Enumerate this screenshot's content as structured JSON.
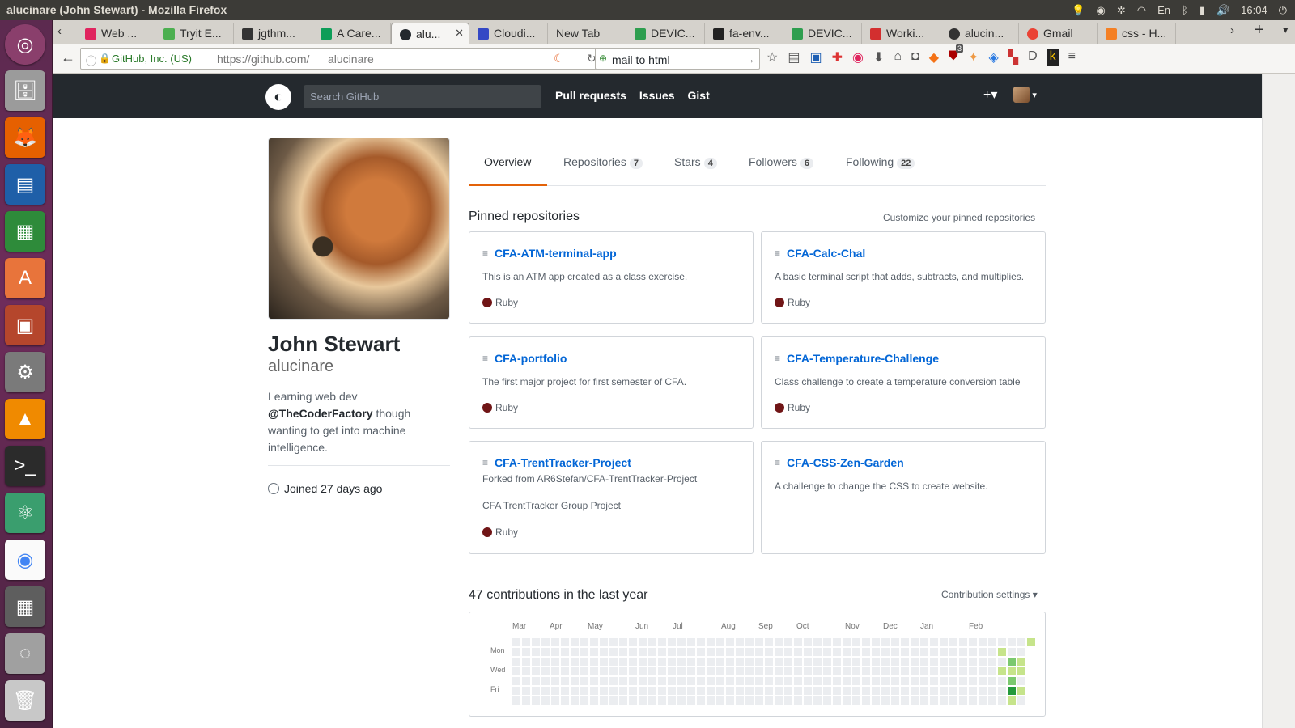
{
  "os": {
    "window_title": "alucinare (John Stewart) - Mozilla Firefox",
    "tray": {
      "lang": "En",
      "time": "16:04"
    }
  },
  "browser": {
    "tabs": [
      {
        "label": "Web ...",
        "color": "#e0245e"
      },
      {
        "label": "Tryit E...",
        "color": "#4caf50"
      },
      {
        "label": "jgthm...",
        "color": "#333333"
      },
      {
        "label": "A Care...",
        "color": "#0d9d58"
      },
      {
        "label": "alu...",
        "color": "#24292e",
        "active": true
      },
      {
        "label": "Cloudi...",
        "color": "#3448c5"
      },
      {
        "label": "New Tab",
        "color": ""
      },
      {
        "label": "DEVIC...",
        "color": "#2e9e4f"
      },
      {
        "label": "fa-env...",
        "color": "#222222"
      },
      {
        "label": "DEVIC...",
        "color": "#2e9e4f"
      },
      {
        "label": "Worki...",
        "color": "#d32f2f"
      },
      {
        "label": "alucin...",
        "color": "#333333"
      },
      {
        "label": "Gmail",
        "color": "#ea4335"
      },
      {
        "label": "css - H...",
        "color": "#f48024"
      }
    ],
    "url": {
      "identity": "GitHub, Inc. (US)",
      "prefix": "https://github.com/",
      "path": "alucinare"
    },
    "search_value": "mail to html",
    "notification_badge": "3"
  },
  "github": {
    "search_placeholder": "Search GitHub",
    "nav": [
      "Pull requests",
      "Issues",
      "Gist"
    ],
    "plus": "+▾"
  },
  "profile": {
    "name": "John Stewart",
    "login": "alucinare",
    "bio_pre": "Learning web dev",
    "bio_mention": "@TheCoderFactory",
    "bio_post": " though wanting to get into machine intelligence.",
    "joined": "Joined 27 days ago"
  },
  "tabs": {
    "overview": "Overview",
    "repositories": "Repositories",
    "repositories_count": "7",
    "stars": "Stars",
    "stars_count": "4",
    "followers": "Followers",
    "followers_count": "6",
    "following": "Following",
    "following_count": "22"
  },
  "pinned": {
    "title": "Pinned repositories",
    "customize": "Customize your pinned repositories",
    "repos": [
      {
        "name": "CFA-ATM-terminal-app",
        "description": "This is an ATM app created as a class exercise.",
        "language": "Ruby"
      },
      {
        "name": "CFA-Calc-Chal",
        "description": "A basic terminal script that adds, subtracts, and multiplies.",
        "language": "Ruby"
      },
      {
        "name": "CFA-portfolio",
        "description": "The first major project for first semester of CFA.",
        "language": "Ruby"
      },
      {
        "name": "CFA-Temperature-Challenge",
        "description": "Class challenge to create a temperature conversion table",
        "language": "Ruby"
      },
      {
        "name": "CFA-TrentTracker-Project",
        "fork": "Forked from AR6Stefan/CFA-TrentTracker-Project",
        "description": "CFA TrentTracker Group Project",
        "language": "Ruby"
      },
      {
        "name": "CFA-CSS-Zen-Garden",
        "description": "A challenge to change the CSS to create website.",
        "language": ""
      }
    ],
    "language_color": "#701516"
  },
  "contributions": {
    "title": "47 contributions in the last year",
    "settings": "Contribution settings ▾",
    "months": [
      "Mar",
      "Apr",
      "May",
      "Jun",
      "Jul",
      "Aug",
      "Sep",
      "Oct",
      "Nov",
      "Dec",
      "Jan",
      "Feb"
    ],
    "days": [
      "Mon",
      "Wed",
      "Fri"
    ]
  }
}
